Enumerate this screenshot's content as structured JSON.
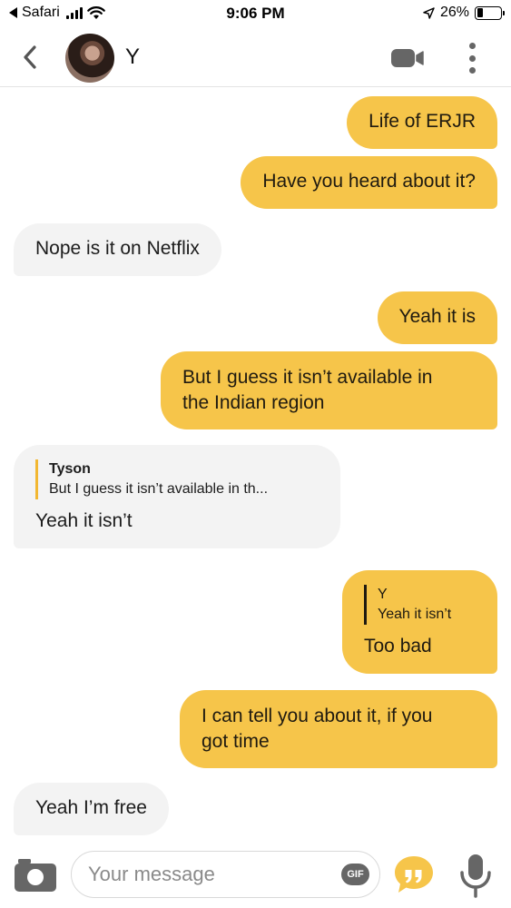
{
  "status_bar": {
    "back_app": "Safari",
    "time": "9:06 PM",
    "battery": "26%",
    "battery_level": 0.26
  },
  "header": {
    "contact_name": "Y",
    "icons": [
      "chevron-left-icon",
      "video-call-icon",
      "more-vertical-icon"
    ]
  },
  "messages": [
    {
      "direction": "out",
      "text": "Life of ERJR"
    },
    {
      "direction": "out",
      "text": "Have you heard about it?"
    },
    {
      "direction": "in",
      "text": "Nope is it on Netflix"
    },
    {
      "direction": "out",
      "text": "Yeah it is"
    },
    {
      "direction": "out",
      "lines": [
        "But I guess it isn’t available in",
        "the Indian region"
      ]
    },
    {
      "direction": "in",
      "reply_to": {
        "name": "Tyson",
        "text": "But I guess it isn’t available in th..."
      },
      "text": "Yeah it isn’t"
    },
    {
      "direction": "out",
      "reply_to": {
        "name": "Y",
        "text": "Yeah it isn’t"
      },
      "text": "Too bad"
    },
    {
      "direction": "out",
      "lines": [
        "I can tell you about it, if you",
        "got time"
      ]
    },
    {
      "direction": "in",
      "text": "Yeah I’m free"
    }
  ],
  "composer": {
    "placeholder": "Your message",
    "gif_label": "GIF",
    "icons": [
      "camera-icon",
      "quote-icon",
      "microphone-icon"
    ]
  },
  "colors": {
    "outgoing_bubble": "#f6c54a",
    "incoming_bubble": "#f3f3f3",
    "accent": "#f2b731"
  }
}
